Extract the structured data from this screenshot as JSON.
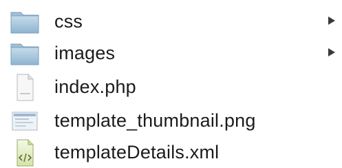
{
  "file_list": {
    "items": [
      {
        "name": "css",
        "kind": "folder",
        "icon": "folder-icon",
        "has_children": true
      },
      {
        "name": "images",
        "kind": "folder",
        "icon": "folder-icon",
        "has_children": true
      },
      {
        "name": "index.php",
        "kind": "file",
        "icon": "php-file-icon",
        "has_children": false
      },
      {
        "name": "template_thumbnail.png",
        "kind": "file",
        "icon": "png-image-icon",
        "has_children": false
      },
      {
        "name": "templateDetails.xml",
        "kind": "file",
        "icon": "xml-file-icon",
        "has_children": false
      }
    ]
  }
}
